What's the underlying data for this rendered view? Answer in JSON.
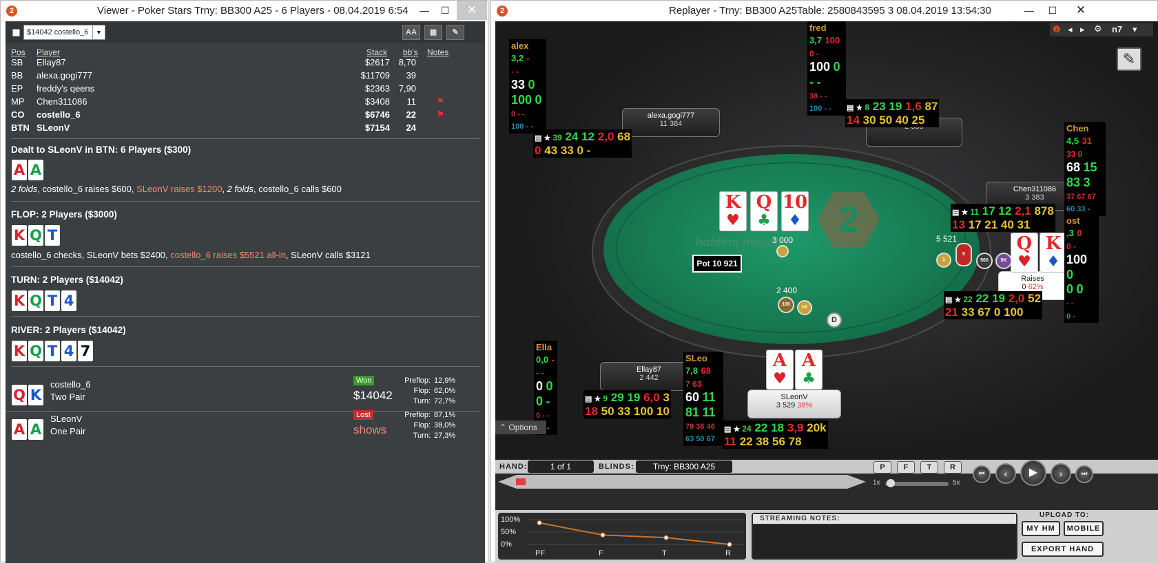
{
  "left": {
    "title": "Viewer - Poker Stars Trny: BB300 A25 - 6 Players - 08.04.2019 6:54",
    "selector": "$14042 costello_6",
    "toolbar": [
      "AA",
      "▦",
      "✎"
    ],
    "headers": {
      "pos": "Pos",
      "player": "Player",
      "stack": "Stack",
      "bbs": "bb's",
      "notes": "Notes"
    },
    "players": [
      {
        "pos": "SB",
        "name": "Ellay87",
        "stack": "$2617",
        "bb": "8,70",
        "bold": false,
        "notes": ""
      },
      {
        "pos": "BB",
        "name": "alexa.gogi777",
        "stack": "$11709",
        "bb": "39",
        "bold": false,
        "notes": ""
      },
      {
        "pos": "EP",
        "name": "freddy's qeens",
        "stack": "$2363",
        "bb": "7,90",
        "bold": false,
        "notes": ""
      },
      {
        "pos": "MP",
        "name": "Chen311086",
        "stack": "$3408",
        "bb": "11",
        "bold": false,
        "notes": "flag"
      },
      {
        "pos": "CO",
        "name": "costello_6",
        "stack": "$6746",
        "bb": "22",
        "bold": true,
        "notes": "flag"
      },
      {
        "pos": "BTN",
        "name": "SLeonV",
        "stack": "$7154",
        "bb": "24",
        "bold": true,
        "notes": ""
      }
    ],
    "dealt": "Dealt to SLeonV in BTN: 6 Players ($300)",
    "dealt_cards": [
      {
        "r": "A",
        "c": "red"
      },
      {
        "r": "A",
        "c": "grn"
      }
    ],
    "preflop_actions": [
      {
        "t": "2 folds",
        "s": "i"
      },
      {
        "t": ", costello_6 raises $600, ",
        "s": ""
      },
      {
        "t": "SLeonV raises $1200",
        "s": "hl"
      },
      {
        "t": ", ",
        "s": ""
      },
      {
        "t": "2 folds",
        "s": "i"
      },
      {
        "t": ", costello_6 calls $600",
        "s": ""
      }
    ],
    "flop": "FLOP: 2 Players ($3000)",
    "flop_cards": [
      {
        "r": "K",
        "c": "red"
      },
      {
        "r": "Q",
        "c": "grn"
      },
      {
        "r": "T",
        "c": "blu"
      }
    ],
    "flop_actions": [
      {
        "t": "costello_6 checks, SLeonV bets $2400, ",
        "s": ""
      },
      {
        "t": "costello_6 raises $5521 all-in",
        "s": "hl"
      },
      {
        "t": ", SLeonV calls $3121",
        "s": ""
      }
    ],
    "turn": "TURN: 2 Players ($14042)",
    "turn_cards": [
      {
        "r": "K",
        "c": "red"
      },
      {
        "r": "Q",
        "c": "grn"
      },
      {
        "r": "T",
        "c": "blu"
      },
      {
        "r": "4",
        "c": "blu"
      }
    ],
    "river": "RIVER: 2 Players ($14042)",
    "river_cards": [
      {
        "r": "K",
        "c": "red"
      },
      {
        "r": "Q",
        "c": "grn"
      },
      {
        "r": "T",
        "c": "blu"
      },
      {
        "r": "4",
        "c": "blu"
      },
      {
        "r": "7",
        "c": "blk"
      }
    ],
    "results": [
      {
        "cards": [
          {
            "r": "Q",
            "c": "red"
          },
          {
            "r": "K",
            "c": "blu"
          }
        ],
        "name": "costello_6",
        "hand": "Two Pair",
        "badge": "Won",
        "badge_color": "#3a9a2a",
        "amount": "$14042",
        "amount_color": "#ffffff",
        "stats": [
          [
            "Preflop:",
            "12,9%"
          ],
          [
            "Flop:",
            "62,0%"
          ],
          [
            "Turn:",
            "72,7%"
          ]
        ]
      },
      {
        "cards": [
          {
            "r": "A",
            "c": "red"
          },
          {
            "r": "A",
            "c": "grn"
          }
        ],
        "name": "SLeonV",
        "hand": "One Pair",
        "badge": "Lost",
        "badge_color": "#c03030",
        "amount": "shows",
        "amount_color": "#f08a7a",
        "stats": [
          [
            "Preflop:",
            "87,1%"
          ],
          [
            "Flop:",
            "38,0%"
          ],
          [
            "Turn:",
            "27,3%"
          ]
        ]
      }
    ]
  },
  "right": {
    "title": "Replayer - Trny: BB300 A25Table: 2580843595 3     08.04.2019 13:54:30",
    "top_menu": "n7",
    "board": [
      {
        "r": "K",
        "s": "♥",
        "c": "red"
      },
      {
        "r": "Q",
        "s": "♣",
        "c": "grn"
      },
      {
        "r": "10",
        "s": "♦",
        "c": "blu"
      }
    ],
    "watermark": "holdem manager",
    "pot": "Pot 10 921",
    "bet_center": "3 000",
    "bet_bottom": "2 400",
    "bet_right": "5 521",
    "dealer": "D",
    "hero_cards": [
      {
        "r": "A",
        "s": "♥",
        "c": "red"
      },
      {
        "r": "A",
        "s": "♣",
        "c": "grn"
      }
    ],
    "villain_cards": [
      {
        "r": "Q",
        "s": "♥",
        "c": "red"
      },
      {
        "r": "K",
        "s": "♦",
        "c": "blu"
      }
    ],
    "seats": {
      "alexa": {
        "name": "alexa.gogi777",
        "chips": "11 384"
      },
      "fred": {
        "name": "",
        "chips": "2 338"
      },
      "chen": {
        "name": "Chen311086",
        "chips": "3 383"
      },
      "costello": {
        "name": "Raises",
        "chips": "0",
        "pct": "62%"
      },
      "ella": {
        "name": "Ellay87",
        "chips": "2 442"
      },
      "hero": {
        "name": "SLeonV",
        "chips": "3 529",
        "pct": "38%"
      }
    },
    "huds": {
      "alex": {
        "name": "alex",
        "l1a": "3,2",
        "l1b": "-",
        "l2": "- -",
        "l3a": "33",
        "l3b": "0",
        "l4a": "100",
        "l4b": "0",
        "l5": "0 - -",
        "l6": "100 - -"
      },
      "fred": {
        "name": "fred",
        "l1a": "3,7",
        "l1b": "100",
        "l2": "0 -",
        "l3a": "100",
        "l3b": "0",
        "l4a": "-",
        "l4b": "-",
        "l5": "38 - -",
        "l6": "100 - -"
      },
      "chen": {
        "name": "Chen",
        "l1a": "4,5",
        "l1b": "31",
        "l2": "33 0",
        "l3a": "68",
        "l3b": "15",
        "l4a": "83",
        "l4b": "3",
        "l5": "37 67 67",
        "l6": "60 33 -"
      },
      "ella": {
        "name": "Ella",
        "l1a": "0,0",
        "l1b": "-",
        "l2": "- -",
        "l3a": "0",
        "l3b": "0",
        "l4a": "0",
        "l4b": "-",
        "l5": "0 - -",
        "l6": "0 - -"
      },
      "sleo": {
        "name": "SLeo",
        "l1a": "7,8",
        "l1b": "68",
        "l2": "7 63",
        "l3a": "60",
        "l3b": "11",
        "l4a": "81",
        "l4b": "11",
        "l5": "79 36 46",
        "l6": "63 50 67"
      },
      "cost": {
        "name": "ost",
        "l1a": ",3",
        "l1b": "0",
        "l2": "0 -",
        "l3a": "100",
        "l3b": "0",
        "l4a": "0",
        "l4b": "0",
        "l5": "- -",
        "l6": "0 -"
      }
    },
    "stat_rows": {
      "alexa": {
        "a": "39",
        "b": "24 12",
        "c": "2,0",
        "d": "68",
        "e": "0",
        "f": "43 33 0 -"
      },
      "fred": {
        "a": "8",
        "b": "23 19",
        "c": "1,6",
        "d": "87",
        "e": "14",
        "f": "30 50 40 25"
      },
      "chen": {
        "a": "11",
        "b": "17 12",
        "c": "2,1",
        "d": "878",
        "e": "13",
        "f": "17 21 40 31"
      },
      "cost": {
        "a": "22",
        "b": "22 19",
        "c": "2,0",
        "d": "52",
        "e": "21",
        "f": "33 67 0 100"
      },
      "ella": {
        "a": "9",
        "b": "29 19",
        "c": "6,0",
        "d": "3",
        "e": "18",
        "f": "50 33 100 10"
      },
      "hero": {
        "a": "24",
        "b": "22 18",
        "c": "3,9",
        "d": "20k",
        "e": "11",
        "f": "22 38 56 78"
      }
    },
    "chips": [
      "1",
      "5",
      "500",
      "5K",
      "100",
      "1K",
      "1K"
    ],
    "options": "Options",
    "controls": {
      "hand_label": "HAND:",
      "hand_value": "1 of 1",
      "blinds_label": "BLINDS:",
      "blinds_value": "Trny: BB300 A25",
      "speed_min": "1x",
      "speed_max": "5x",
      "buttons": [
        "P",
        "F",
        "T",
        "R"
      ]
    },
    "graph": {
      "y_labels": [
        "100%",
        "50%",
        "0%"
      ],
      "x_labels": [
        "PF",
        "F",
        "T",
        "R"
      ],
      "values": [
        87.1,
        38.0,
        27.3,
        0
      ]
    },
    "streaming_notes": "STREAMING NOTES:",
    "upload": {
      "label": "UPLOAD TO:",
      "my_hm": "MY HM",
      "mobile": "MOBILE",
      "export": "EXPORT HAND"
    }
  }
}
